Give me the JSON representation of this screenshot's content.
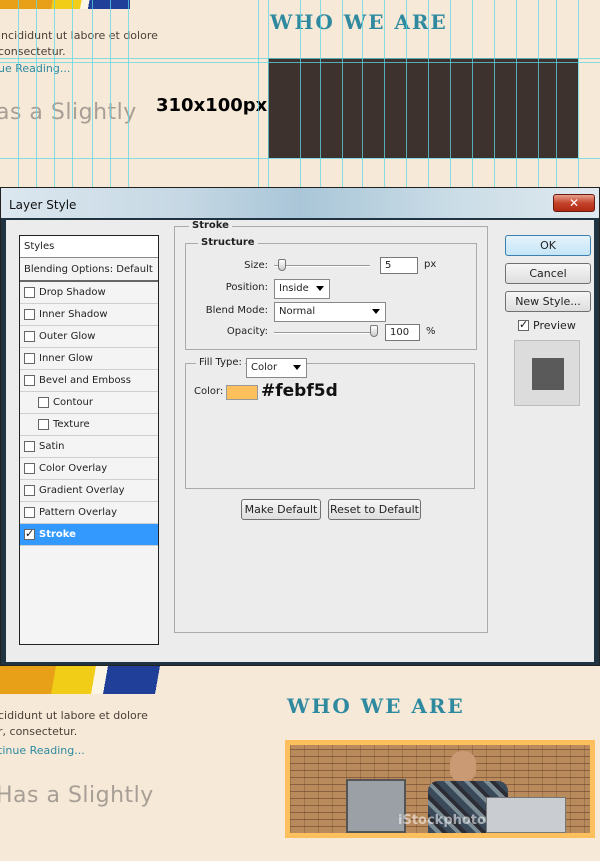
{
  "mockup_top": {
    "heading": "WHO WE ARE",
    "lorem_line1": "incididunt ut labore et dolore",
    "lorem_line2": "consectetur.",
    "continue_link": "ue Reading...",
    "slightly_text": "as a Slightly",
    "size_label": "310x100px",
    "box_color": "#3d322d",
    "guide_color": "#5ed7e6"
  },
  "dialog": {
    "title": "Layer Style",
    "close_symbol": "✕",
    "styles_header": "Styles",
    "blending_options": "Blending Options: Default",
    "styles": [
      {
        "label": "Drop Shadow",
        "checked": false
      },
      {
        "label": "Inner Shadow",
        "checked": false
      },
      {
        "label": "Outer Glow",
        "checked": false
      },
      {
        "label": "Inner Glow",
        "checked": false
      },
      {
        "label": "Bevel and Emboss",
        "checked": false
      },
      {
        "label": "Contour",
        "checked": false
      },
      {
        "label": "Texture",
        "checked": false
      },
      {
        "label": "Satin",
        "checked": false
      },
      {
        "label": "Color Overlay",
        "checked": false
      },
      {
        "label": "Gradient Overlay",
        "checked": false
      },
      {
        "label": "Pattern Overlay",
        "checked": false
      },
      {
        "label": "Stroke",
        "checked": true
      }
    ],
    "stroke": {
      "group_title": "Stroke",
      "structure_title": "Structure",
      "size_label": "Size:",
      "size_value": "5",
      "size_unit": "px",
      "position_label": "Position:",
      "position_value": "Inside",
      "blend_label": "Blend Mode:",
      "blend_value": "Normal",
      "opacity_label": "Opacity:",
      "opacity_value": "100",
      "opacity_unit": "%",
      "fill_type_label": "Fill Type:",
      "fill_type_value": "Color",
      "color_label": "Color:",
      "color_hex": "#febf5d",
      "make_default": "Make Default",
      "reset_default": "Reset to Default"
    },
    "buttons": {
      "ok": "OK",
      "cancel": "Cancel",
      "new_style": "New Style...",
      "preview": "Preview"
    },
    "preview_checked": true
  },
  "mockup_bottom": {
    "heading": "WHO WE ARE",
    "lorem_line1": "cididunt ut labore et dolore",
    "lorem_line2": "r, consectetur.",
    "continue_link": "tinue Reading...",
    "slightly_text": "Has a Slightly",
    "photo_watermark": "iStockphoto",
    "frame_color": "#febf5d"
  }
}
